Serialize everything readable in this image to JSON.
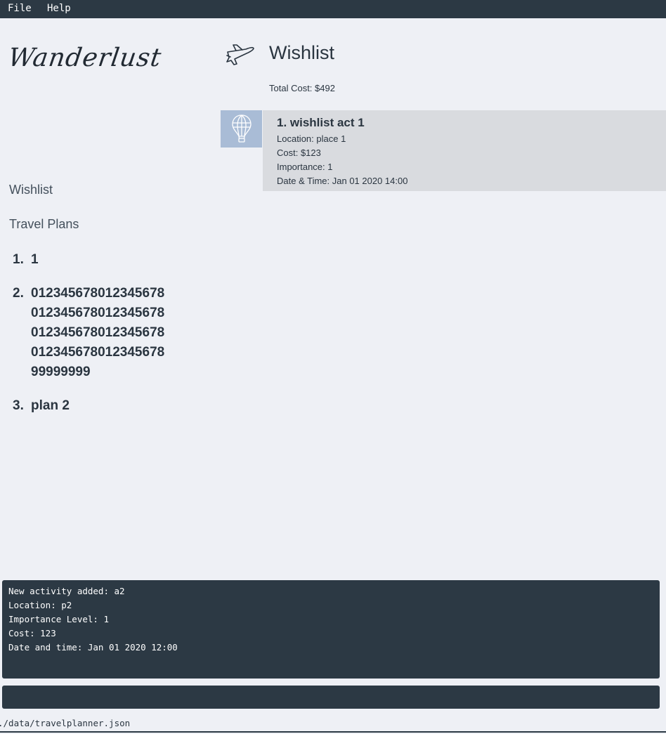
{
  "menu": {
    "items": [
      {
        "label": "File"
      },
      {
        "label": "Help"
      }
    ]
  },
  "logo": {
    "text": "Wanderlust"
  },
  "sidebar": {
    "wishlist_label": "Wishlist",
    "travel_plans_label": "Travel Plans",
    "plans": [
      {
        "index": "1.",
        "name": "1"
      },
      {
        "index": "2.",
        "name": "01234567801234567801234567801234567801234567801234567801234567801234567899999999"
      },
      {
        "index": "3.",
        "name": "plan 2"
      }
    ]
  },
  "main": {
    "title": "Wishlist",
    "icon": "airplane-icon",
    "total_cost": "Total Cost: $492",
    "activities": [
      {
        "title": "1.  wishlist act 1",
        "icon": "hot-air-balloon-icon",
        "location": "Location: place 1",
        "cost": "Cost: $123",
        "importance": "Importance: 1",
        "datetime": "Date & Time: Jan 01 2020 14:00"
      }
    ]
  },
  "result_display": {
    "lines": [
      "New activity added: a2",
      "Location: p2",
      "Importance Level: 1",
      "Cost: 123",
      "Date and time: Jan 01 2020 12:00"
    ]
  },
  "command_box": {
    "value": ""
  },
  "status_bar": {
    "path": "./data/travelplanner.json"
  },
  "colors": {
    "dark": "#2c3944",
    "background": "#eef0f5",
    "card": "#d9dbdf",
    "card_icon": "#a9bcd6"
  }
}
